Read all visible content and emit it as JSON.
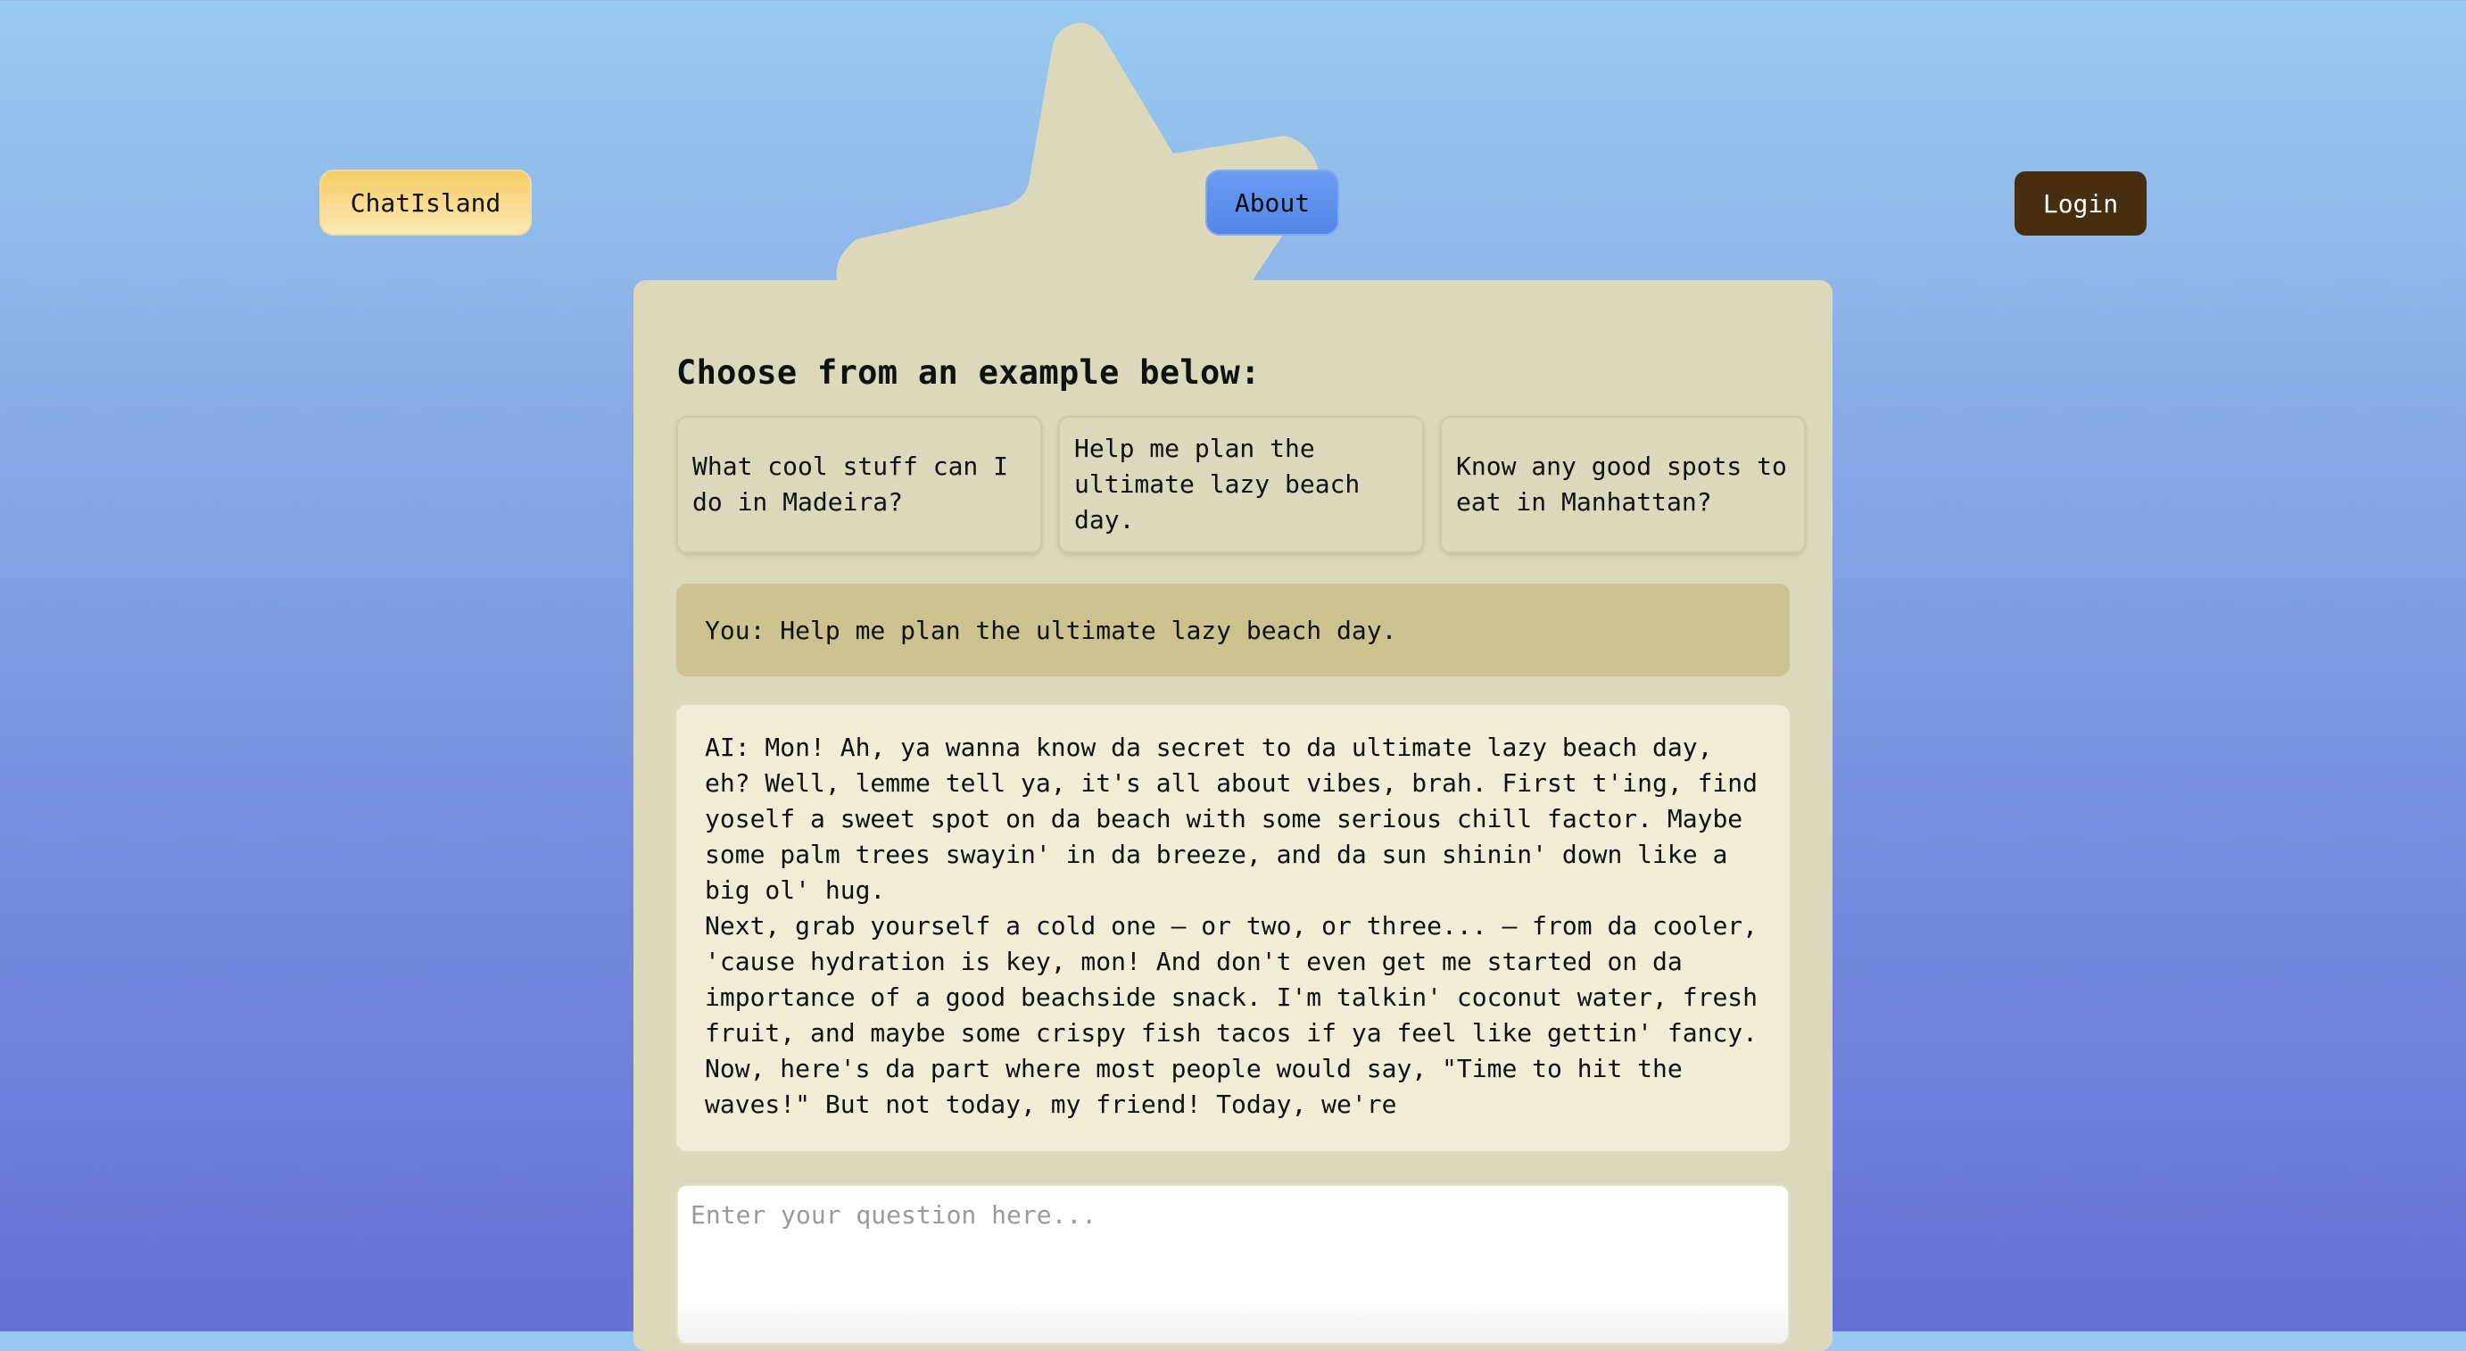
{
  "nav": {
    "brand_label": "ChatIsland",
    "about_label": "About",
    "login_label": "Login"
  },
  "main": {
    "heading": "Choose from an example below:",
    "examples": [
      "What cool stuff can I do in Madeira?",
      "Help me plan the ultimate lazy beach day.",
      "Know any good spots to eat in Manhattan?"
    ],
    "user_message": "You: Help me plan the ultimate lazy beach day.",
    "ai_message": {
      "paragraph_1": "AI: Mon! Ah, ya wanna know da secret to da ultimate lazy beach day, eh? Well, lemme tell ya, it's all about vibes, brah. First t'ing, find yoself a sweet spot on da beach with some serious chill factor. Maybe some palm trees swayin' in da breeze, and da sun shinin' down like a big ol' hug.",
      "paragraph_2": "Next, grab yourself a cold one — or two, or three... — from da cooler, 'cause hydration is key, mon! And don't even get me started on da importance of a good beachside snack. I'm talkin' coconut water, fresh fruit, and maybe some crispy fish tacos if ya feel like gettin' fancy. Now, here's da part where most people would say, \"Time to hit the waves!\" But not today, my friend! Today, we're"
    },
    "input": {
      "placeholder": "Enter your question here...",
      "value": ""
    }
  },
  "colors": {
    "background_top": "#99c9ee",
    "background_bottom": "#6670d6",
    "panel": "#dcd8bb",
    "user_bubble": "#cbc290",
    "ai_bubble": "#f0ecd5",
    "brand_button": "#f6cc66",
    "about_button": "#5f92ee",
    "login_button": "#482e11"
  }
}
